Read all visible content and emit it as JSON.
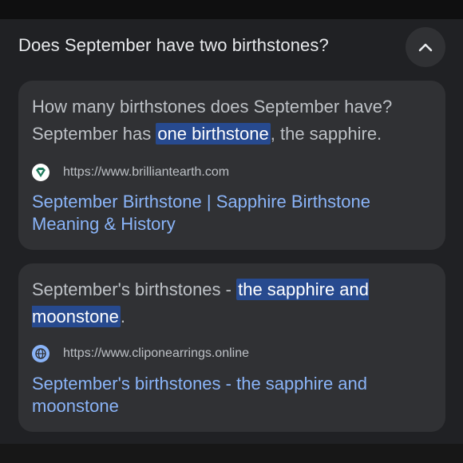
{
  "question": "Does September have two birthstones?",
  "results": [
    {
      "snippet": {
        "pre": "How many birthstones does September have? September has ",
        "highlight": "one birthstone",
        "post": ", the sapphire."
      },
      "url": "https://www.brilliantearth.com",
      "title": "September Birthstone | Sapphire Birthstone Meaning & History",
      "favicon": "brilliant-earth-logo-icon"
    },
    {
      "snippet": {
        "pre": "September's birthstones - ",
        "highlight": "the sapphire and moonstone",
        "post": "."
      },
      "url": "https://www.cliponearrings.online",
      "title": "September's birthstones - the sapphire and moonstone",
      "favicon": "globe-icon"
    }
  ],
  "colors": {
    "background": "#202124",
    "card": "#303134",
    "link": "#8ab4f8",
    "highlight": "#274a8f"
  }
}
